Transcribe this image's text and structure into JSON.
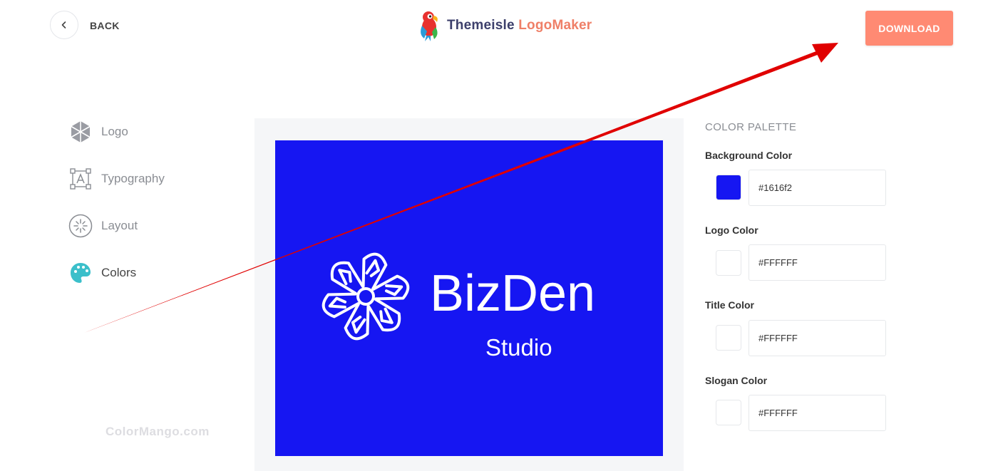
{
  "header": {
    "back_label": "BACK",
    "brand_part1": "Themeisle",
    "brand_part2": "LogoMaker",
    "download_label": "DOWNLOAD"
  },
  "sidebar": {
    "items": [
      {
        "label": "Logo",
        "icon": "hexagon-logo-icon"
      },
      {
        "label": "Typography",
        "icon": "typography-icon"
      },
      {
        "label": "Layout",
        "icon": "layout-icon"
      },
      {
        "label": "Colors",
        "icon": "palette-icon",
        "active": true
      }
    ]
  },
  "preview": {
    "title": "BizDen",
    "slogan": "Studio"
  },
  "palette": {
    "title": "COLOR PALETTE",
    "fields": [
      {
        "label": "Background Color",
        "value": "#1616f2",
        "color": "#1616f2"
      },
      {
        "label": "Logo Color",
        "value": "#FFFFFF",
        "color": "#FFFFFF"
      },
      {
        "label": "Title Color",
        "value": "#FFFFFF",
        "color": "#FFFFFF"
      },
      {
        "label": "Slogan Color",
        "value": "#FFFFFF",
        "color": "#FFFFFF"
      }
    ]
  },
  "colors": {
    "accent": "#ff8a73",
    "canvas_background": "#1616f2",
    "annotation_arrow": "#e00000"
  },
  "watermark": "ColorMango.com"
}
